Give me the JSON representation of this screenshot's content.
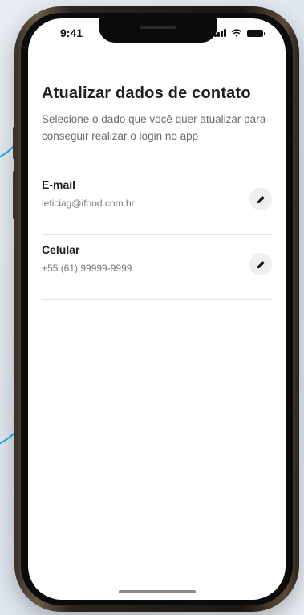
{
  "status_bar": {
    "time": "9:41"
  },
  "page": {
    "title": "Atualizar dados de contato",
    "subtitle": "Selecione o dado que você quer atualizar para conseguir realizar o login no app"
  },
  "contacts": [
    {
      "label": "E-mail",
      "value": "leticiag@ifood.com.br",
      "icon": "pencil-icon"
    },
    {
      "label": "Celular",
      "value": "+55 (61) 99999-9999",
      "icon": "pencil-icon"
    }
  ],
  "colors": {
    "accent_curve": "#1aa7e6",
    "edit_button_bg": "#efefef"
  }
}
